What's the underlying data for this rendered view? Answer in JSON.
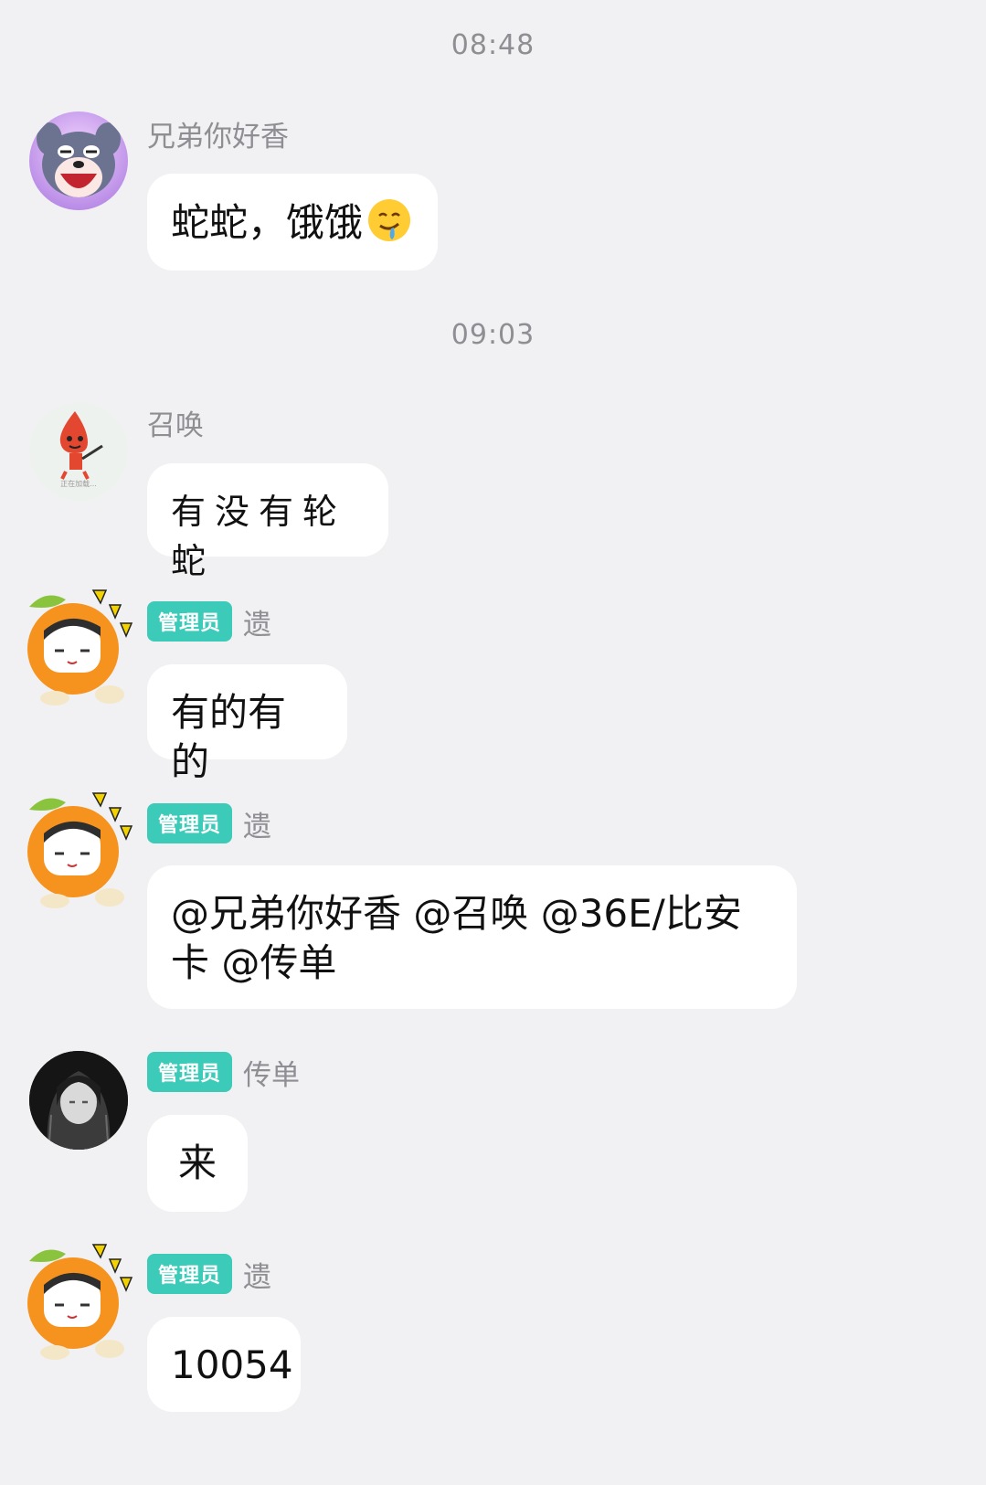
{
  "timestamps": [
    "08:48",
    "09:03"
  ],
  "messages": [
    {
      "sender": "兄弟你好香",
      "badge": "",
      "text": "蛇蛇，饿饿",
      "emoji": "drooling-face"
    },
    {
      "sender": "召唤",
      "badge": "",
      "text": "有没有轮蛇",
      "avatar_caption": "正在加载..."
    },
    {
      "sender": "遗",
      "badge": "管理员",
      "text": "有的有的"
    },
    {
      "sender": "遗",
      "badge": "管理员",
      "text": "@兄弟你好香 @召唤 @36E/比安卡 @传单"
    },
    {
      "sender": "传单",
      "badge": "管理员",
      "text": "来"
    },
    {
      "sender": "遗",
      "badge": "管理员",
      "text": "10054"
    }
  ],
  "colors": {
    "background": "#f1f1f3",
    "bubble": "#ffffff",
    "badge": "#3ccbb9",
    "meta_text": "#8e8e93"
  }
}
